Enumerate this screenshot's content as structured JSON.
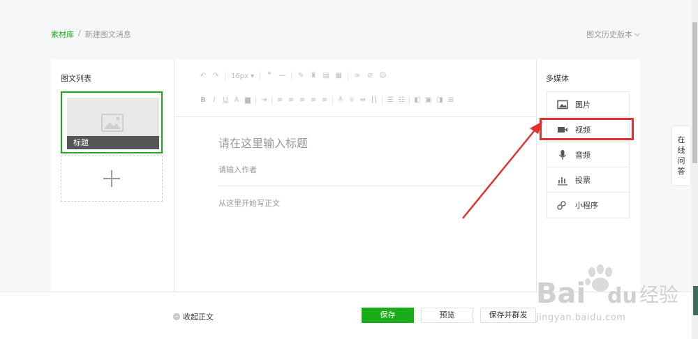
{
  "breadcrumb": {
    "home": "素材库",
    "separator": "/",
    "current": "新建图文消息"
  },
  "history_label": "图文历史版本",
  "left_panel": {
    "title": "图文列表",
    "article_title": "标题"
  },
  "toolbar": {
    "font_size": "16px"
  },
  "editor": {
    "title_placeholder": "请在这里输入标题",
    "author_placeholder": "请输入作者",
    "content_placeholder": "从这里开始写正文"
  },
  "media_panel": {
    "title": "多媒体",
    "items": [
      {
        "label": "图片",
        "icon": "image-icon"
      },
      {
        "label": "视频",
        "icon": "video-icon"
      },
      {
        "label": "音频",
        "icon": "microphone-icon"
      },
      {
        "label": "投票",
        "icon": "bar-chart-icon"
      },
      {
        "label": "小程序",
        "icon": "mini-program-icon"
      }
    ]
  },
  "float_help": {
    "chars": [
      "在",
      "线",
      "问",
      "答"
    ]
  },
  "bottom_bar": {
    "collapse_label": "收起正文",
    "save_label": "保存",
    "preview_label": "预览",
    "publish_label": "保存并群发"
  },
  "watermark": {
    "brand": "Bai经验",
    "url": "jingyan.baidu.com"
  },
  "colors": {
    "accent": "#1aad19",
    "highlight": "#e23131"
  }
}
